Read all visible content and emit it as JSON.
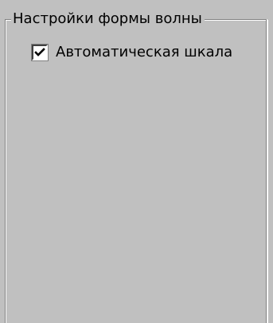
{
  "group": {
    "title": "Настройки формы волны"
  },
  "auto_scale": {
    "label": "Автоматическая шкала",
    "checked": true
  },
  "colors": {
    "panel_background": "#c0c0c0",
    "border_shadow": "#808080",
    "border_highlight": "#ffffff",
    "checkbox_background": "#ffffff"
  },
  "icons": {
    "checkmark": "checkmark-icon"
  }
}
